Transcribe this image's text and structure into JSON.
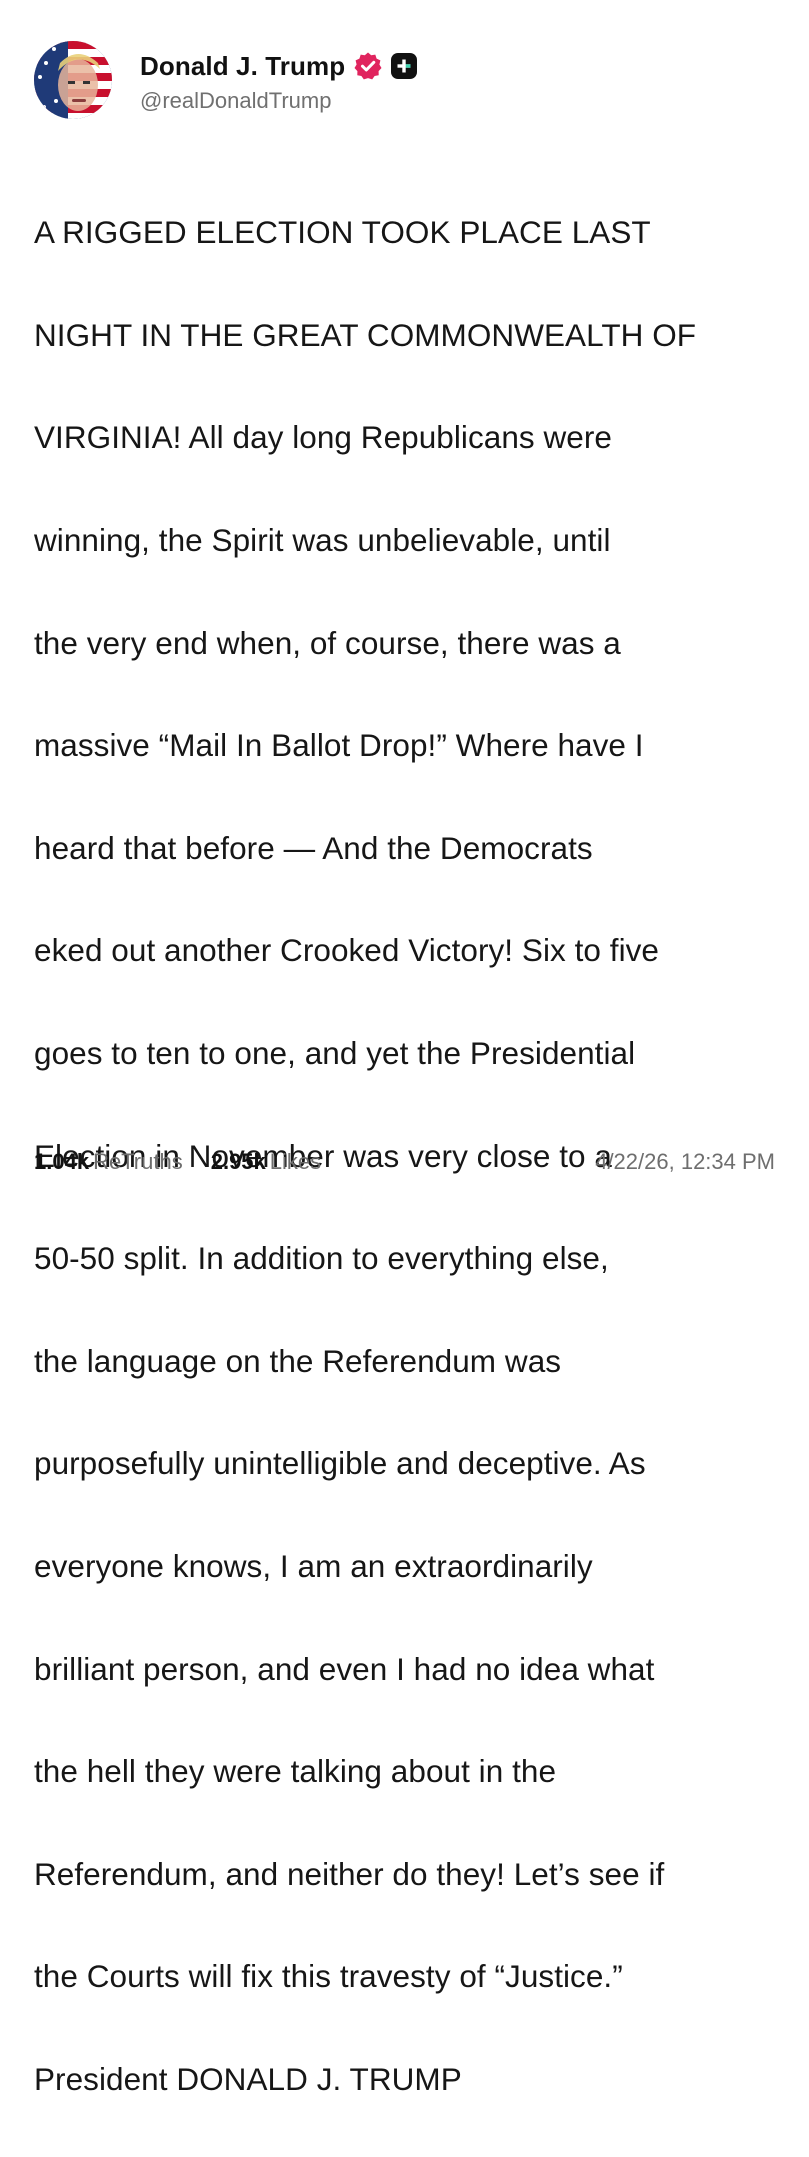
{
  "author": {
    "display_name": "Donald J. Trump",
    "handle": "@realDonaldTrump",
    "verified_color": "#e0245e"
  },
  "post": {
    "lines": [
      "A RIGGED ELECTION TOOK PLACE LAST",
      "NIGHT IN THE GREAT COMMONWEALTH OF",
      "VIRGINIA! All day long Republicans were",
      "winning, the Spirit was unbelievable, until",
      "the very end when, of course, there was a",
      "massive “Mail In Ballot Drop!” Where have I",
      "heard that before — And the Democrats",
      "eked out another Crooked Victory! Six to five",
      "goes to ten to one, and yet the Presidential",
      "Election in November was very close to a",
      "50-50 split. In addition to everything else,",
      "the language on the Referendum was",
      "purposefully unintelligible and deceptive. As",
      "everyone knows, I am an extraordinarily",
      "brilliant person, and even I had no idea what",
      "the hell they were talking about in the",
      "Referendum, and neither do they! Let’s see if",
      "the Courts will fix this travesty of “Justice.”",
      "President DONALD J. TRUMP"
    ]
  },
  "stats": {
    "retruths_count": "1.04k",
    "retruths_label": "ReTruths",
    "likes_count": "2.95k",
    "likes_label": "Likes"
  },
  "timestamp": "4/22/26, 12:34 PM"
}
